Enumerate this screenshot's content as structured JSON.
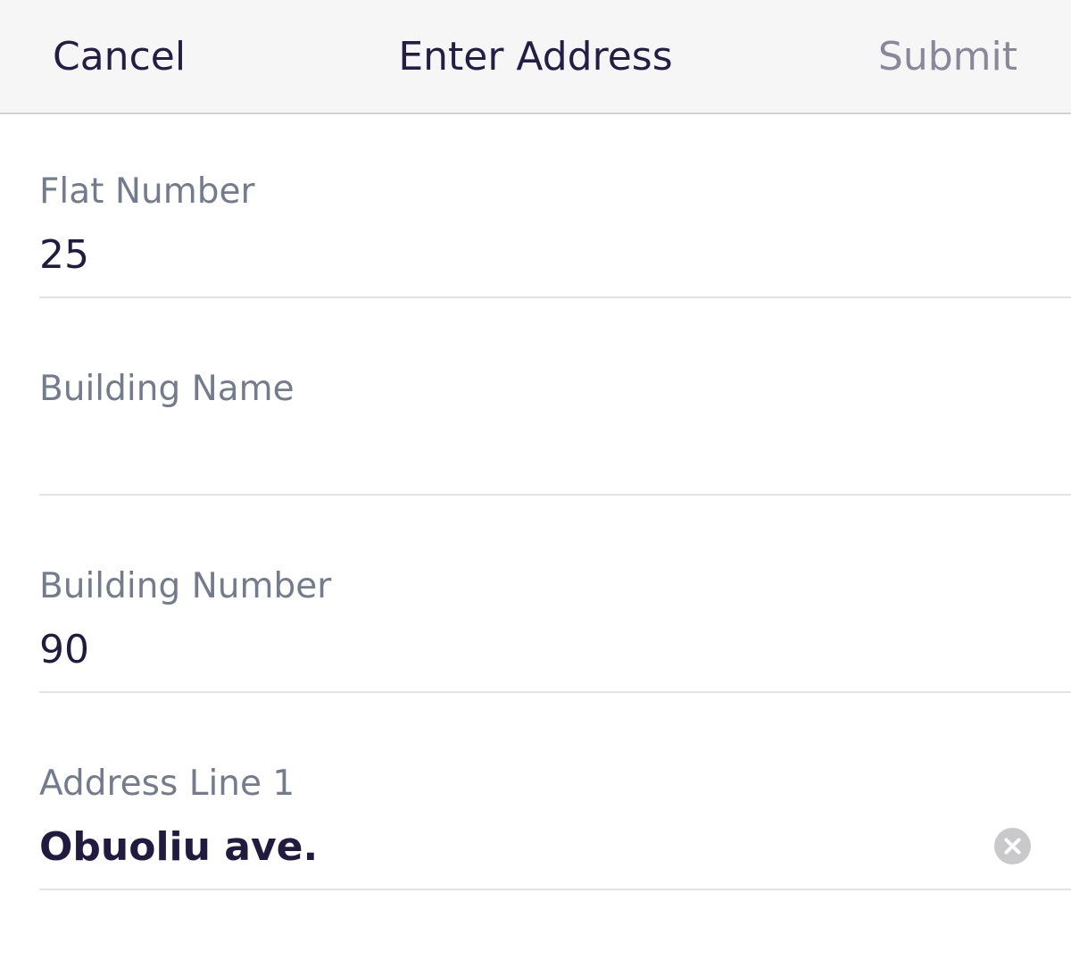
{
  "header": {
    "cancel_label": "Cancel",
    "title": "Enter Address",
    "submit_label": "Submit"
  },
  "fields": [
    {
      "label": "Flat Number",
      "value": "25"
    },
    {
      "label": "Building Name",
      "value": ""
    },
    {
      "label": "Building Number",
      "value": "90"
    },
    {
      "label": "Address Line 1",
      "value": "Obuoliu ave."
    }
  ],
  "icons": {
    "clear": "clear-icon"
  },
  "colors": {
    "primary_text": "#261d44",
    "disabled_text": "#8b8699",
    "label_text": "#737c8c",
    "navbar_bg": "#f6f6f6"
  }
}
